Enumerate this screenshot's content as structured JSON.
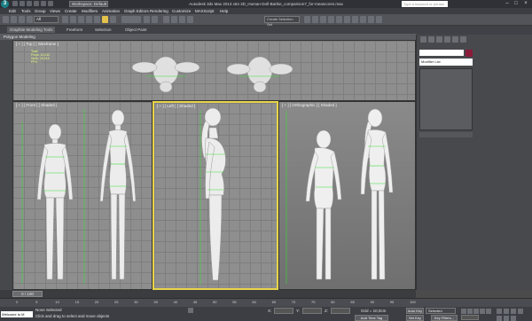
{
  "app": {
    "title": "Autodesk 3ds Max 2013 x64    3D_Human-Doll-Barbie_comparison7_for-meascores.max",
    "logo_letter": "3",
    "workspace": "Workspace: Default",
    "search_placeholder": "Type a keyword or phrase"
  },
  "menu": [
    "Edit",
    "Tools",
    "Group",
    "Views",
    "Create",
    "Modifiers",
    "Animation",
    "Graph Editors",
    "Rendering",
    "Customize",
    "MAXScript",
    "Help"
  ],
  "toolbar": {
    "selection_filter": "All",
    "named_selection": "Create Selection Set"
  },
  "ribbon": {
    "tabs": [
      "Graphite Modeling Tools",
      "Freeform",
      "Selection",
      "Object Paint"
    ],
    "panel": "Polygon Modeling"
  },
  "viewports": {
    "top": {
      "label": "[ + ] [ Top ] [ Wireframe ]",
      "stats": [
        "Total",
        "Polys: 10,412",
        "Verts: 10,014",
        "FPS: ..."
      ]
    },
    "front": {
      "label": "[ + ] [ Front ] [ Shaded ]"
    },
    "left": {
      "label": "[ + ] [ Left ] [ Shaded ]"
    },
    "persp": {
      "label": "[ + ] [ Orthographic ] [ Shaded ]"
    }
  },
  "command_panel": {
    "modifier_list": "Modifier List"
  },
  "timeline": {
    "slider": "0 / 100",
    "ticks": [
      "0",
      "5",
      "10",
      "15",
      "20",
      "25",
      "30",
      "35",
      "40",
      "45",
      "50",
      "55",
      "60",
      "65",
      "70",
      "75",
      "80",
      "85",
      "90",
      "95",
      "100"
    ]
  },
  "status": {
    "maxscript": "Welcome to M",
    "selection": "None Selected",
    "prompt": "Click and drag to select and move objects",
    "x_label": "X:",
    "y_label": "Y:",
    "z_label": "Z:",
    "grid": "Grid = 10,0cm",
    "add_time_tag": "Add Time Tag",
    "auto_key": "Auto Key",
    "set_key": "Set Key",
    "selected": "Selected",
    "key_filters": "Key Filters..."
  },
  "colors": {
    "accent": "#e8d44a",
    "swatch": "#8a1b3a",
    "grid": "#8e8e8e"
  }
}
